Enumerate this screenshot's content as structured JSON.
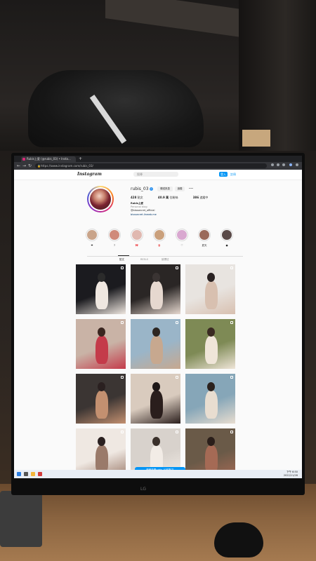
{
  "browser": {
    "tab_title": "Rubis上愛 (@rubis_03) • Insta...",
    "new_tab_symbol": "+",
    "url": "https://www.instagram.com/rubis_03/",
    "nav": {
      "back": "←",
      "forward": "→",
      "reload": "↻"
    }
  },
  "instagram": {
    "logo": "Instagram",
    "search_placeholder": "搜尋",
    "login_label": "登入",
    "signup_label": "註冊",
    "profile": {
      "username": "rubis_03",
      "verified_mark": "✓",
      "follow_label": "傳送訊息",
      "message_label": "追蹤",
      "more_label": "•••",
      "stats": [
        {
          "value": "428",
          "label": "貼文"
        },
        {
          "value": "40.9 萬",
          "label": "位粉絲"
        },
        {
          "value": "386",
          "label": "追蹤中"
        }
      ],
      "display_name": "Rubis上愛",
      "category": "Personal blog",
      "bio_line1": "@bisssecret_official",
      "bio_link": "bisssecret.linewb.me"
    },
    "highlights": [
      {
        "label": "❤",
        "color": "#c9a48a"
      },
      {
        "label": "?",
        "color": "#d08a7a"
      },
      {
        "label": "🎀",
        "color": "#e0b8b0"
      },
      {
        "label": "👙",
        "color": "#caa07c"
      },
      {
        "label": "♡",
        "color": "#d9a8d0"
      },
      {
        "label": "夏天",
        "color": "#9a6a5a"
      },
      {
        "label": "●",
        "color": "#5a4a48"
      }
    ],
    "profile_tabs": [
      {
        "label": "貼文",
        "active": true
      },
      {
        "label": "REELS",
        "active": false
      },
      {
        "label": "被標註",
        "active": false
      }
    ],
    "bottom_banner": "繼續查看rubis_03的貼文"
  },
  "taskbar": {
    "time": "下午 6:50",
    "date": "2022/11/28"
  },
  "monitor_brand": "LG"
}
